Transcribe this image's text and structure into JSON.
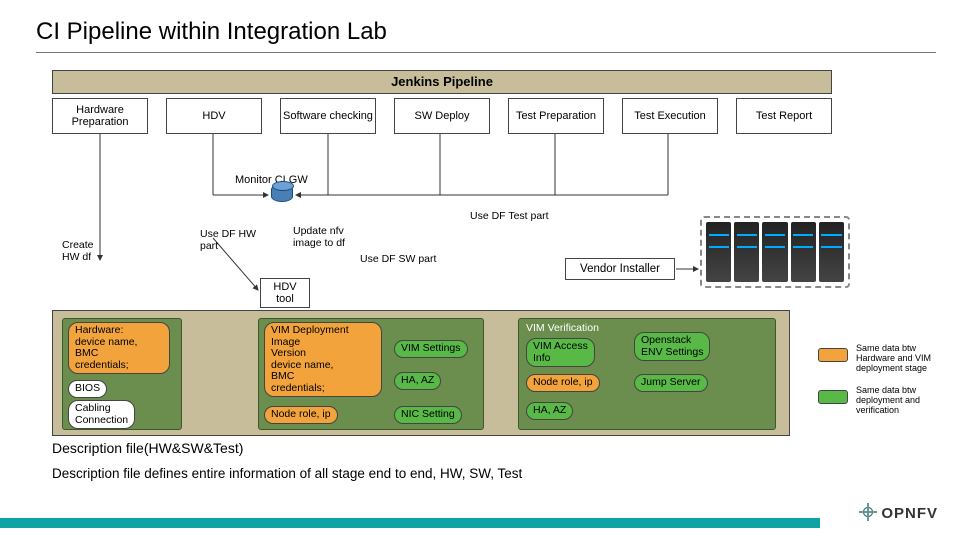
{
  "title": "CI Pipeline within Integration Lab",
  "pipeline_label": "Jenkins Pipeline",
  "stages": [
    "Hardware Preparation",
    "HDV",
    "Software checking",
    "SW Deploy",
    "Test Preparation",
    "Test Execution",
    "Test Report"
  ],
  "monitor_label": "Monitor CI GW",
  "labels": {
    "create_hw_df": "Create\nHW df",
    "use_df_hw": "Use DF HW\npart",
    "update_nfv": "Update nfv\nimage to df",
    "use_df_sw": "Use DF SW part",
    "use_df_test": "Use DF Test part",
    "hdv_tool": "HDV\ntool",
    "vendor_installer": "Vendor Installer"
  },
  "hw_pane": {
    "hardware": "Hardware:\ndevice name,\nBMC\ncredentials;",
    "bios": "BIOS",
    "cabling": "Cabling\nConnection"
  },
  "sw_pane": {
    "vim_deploy": "VIM Deployment\nImage\nVersion\ndevice name,\nBMC\ncredentials;",
    "node_role": "Node role, ip",
    "vim_settings": "VIM Settings",
    "ha_az": "HA, AZ",
    "nic": "NIC Setting"
  },
  "test_pane": {
    "vim_verif": "VIM Verification",
    "vim_access": "VIM Access\nInfo",
    "node_role": "Node role, ip",
    "ha_az": "HA, AZ",
    "openstack": "Openstack\nENV Settings",
    "jump": "Jump Server"
  },
  "df_title": "Description file(HW&SW&Test)",
  "df_desc": "Description file defines entire information of all stage end to end, HW, SW, Test",
  "legend": {
    "orange": "Same data btw Hardware and VIM deployment stage",
    "green": "Same data btw deployment and verification"
  },
  "logo_text": "OPNFV"
}
